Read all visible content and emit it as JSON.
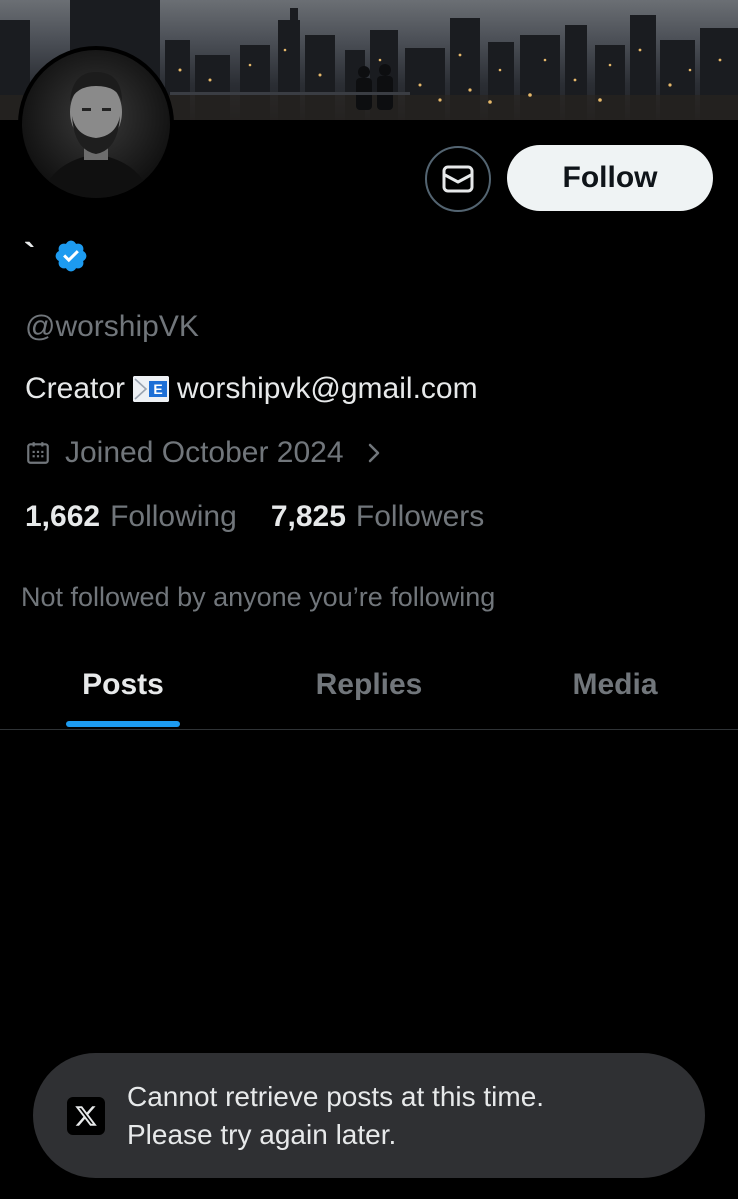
{
  "profile": {
    "display_name": "`",
    "handle": "@worshipVK",
    "bio_prefix": "Creator",
    "bio_emoji": "e-mail-emoji",
    "bio_email": "worshipvk@gmail.com",
    "joined": "Joined October 2024",
    "following_count": "1,662",
    "following_label": "Following",
    "followers_count": "7,825",
    "followers_label": "Followers",
    "not_followed_text": "Not followed by anyone you’re following"
  },
  "actions": {
    "follow_label": "Follow",
    "message_icon": "envelope-icon"
  },
  "tabs": [
    {
      "label": "Posts",
      "active": true
    },
    {
      "label": "Replies",
      "active": false
    },
    {
      "label": "Media",
      "active": false
    }
  ],
  "toast": {
    "line1": "Cannot retrieve posts at this time.",
    "line2": "Please try again later.",
    "icon": "x-logo-icon"
  },
  "colors": {
    "background": "#000000",
    "accent": "#1d9bf0",
    "muted_text": "#71767b",
    "primary_text": "#e7e9ea",
    "follow_button_bg": "#eff3f4",
    "toast_bg": "#2f3033"
  }
}
